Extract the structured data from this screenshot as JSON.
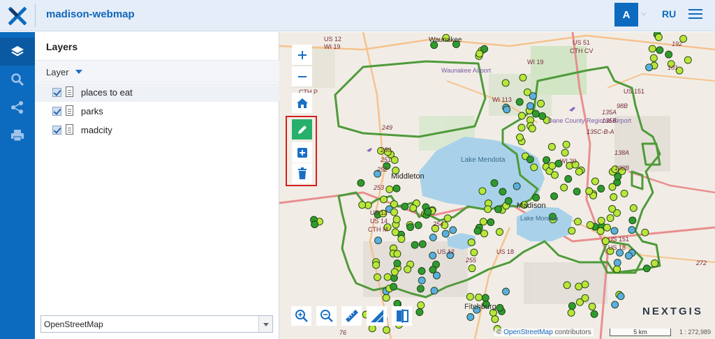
{
  "app": {
    "title": "madison-webmap"
  },
  "user": {
    "initial": "A"
  },
  "lang": {
    "label": "RU"
  },
  "panel": {
    "title": "Layers",
    "layer_header": "Layer",
    "layers": [
      {
        "name": "places to eat",
        "checked": true,
        "selected": true
      },
      {
        "name": "parks",
        "checked": true,
        "selected": false
      },
      {
        "name": "madcity",
        "checked": true,
        "selected": false
      }
    ],
    "basemap": "OpenStreetMap"
  },
  "map": {
    "place_labels": [
      "Waunakee",
      "Waunakee Airport",
      "Lake Mendota",
      "Lake Monona",
      "Dane County Regional Airport",
      "Fitchburg",
      "Madison",
      "Middleton"
    ],
    "road_labels": [
      "US 12",
      "WI 19",
      "WI 19",
      "US 51",
      "CTH CV",
      "CTH P",
      "WI 113",
      "US 151",
      "WI 30",
      "US 12",
      "US 14",
      "CTH M",
      "US 12",
      "US 18",
      "US 151",
      "US 18",
      "249",
      "250",
      "251",
      "252",
      "253",
      "254",
      "255",
      "135A",
      "135B",
      "138A",
      "138B",
      "98B",
      "272",
      "101",
      "192",
      "76",
      "135C-B-A"
    ],
    "attribution_symbol": "©",
    "attribution_link": "OpenStreetMap",
    "attribution_rest": "contributors",
    "scale": "5 km",
    "scale_ratio": "1 : 272,989",
    "brand": "NEXTGIS",
    "colors": {
      "boundary": "#4f9a3a",
      "point_green": "#2e9b2e",
      "point_lime": "#b9e639",
      "point_blue": "#5aaee0",
      "water": "#a9d2ea",
      "highlight": "#d62020"
    }
  }
}
